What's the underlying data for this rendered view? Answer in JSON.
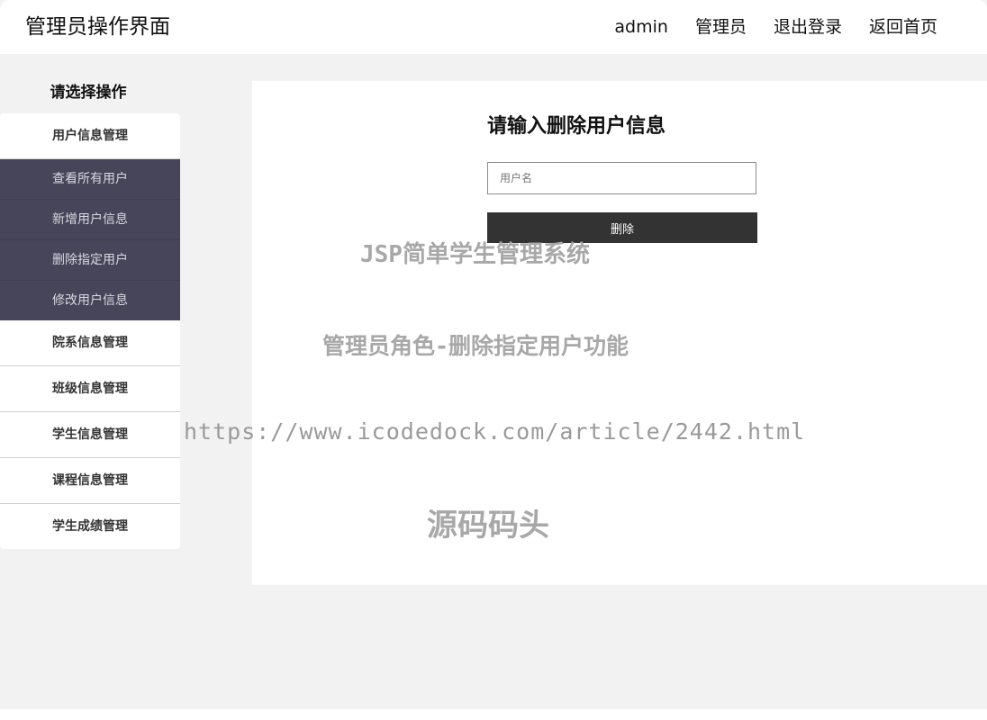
{
  "header": {
    "title": "管理员操作界面",
    "nav": [
      "admin",
      "管理员",
      "退出登录",
      "返回首页"
    ]
  },
  "sidebar": {
    "title": "请选择操作",
    "groups": [
      {
        "label": "用户信息管理",
        "expanded": true,
        "items": [
          "查看所有用户",
          "新增用户信息",
          "删除指定用户",
          "修改用户信息"
        ]
      },
      {
        "label": "院系信息管理"
      },
      {
        "label": "班级信息管理"
      },
      {
        "label": "学生信息管理"
      },
      {
        "label": "课程信息管理"
      },
      {
        "label": "学生成绩管理"
      }
    ]
  },
  "form": {
    "title": "请输入删除用户信息",
    "username_placeholder": "用户名",
    "username_value": "",
    "submit_label": "删除"
  },
  "watermark": {
    "line1": "JSP简单学生管理系统",
    "line2": "管理员角色-删除指定用户功能",
    "line3": "https://www.icodedock.com/article/2442.html",
    "line4": "源码码头"
  },
  "colors": {
    "submenu_bg": "#474559",
    "button_bg": "#333333",
    "page_bg": "#f2f2f2"
  }
}
